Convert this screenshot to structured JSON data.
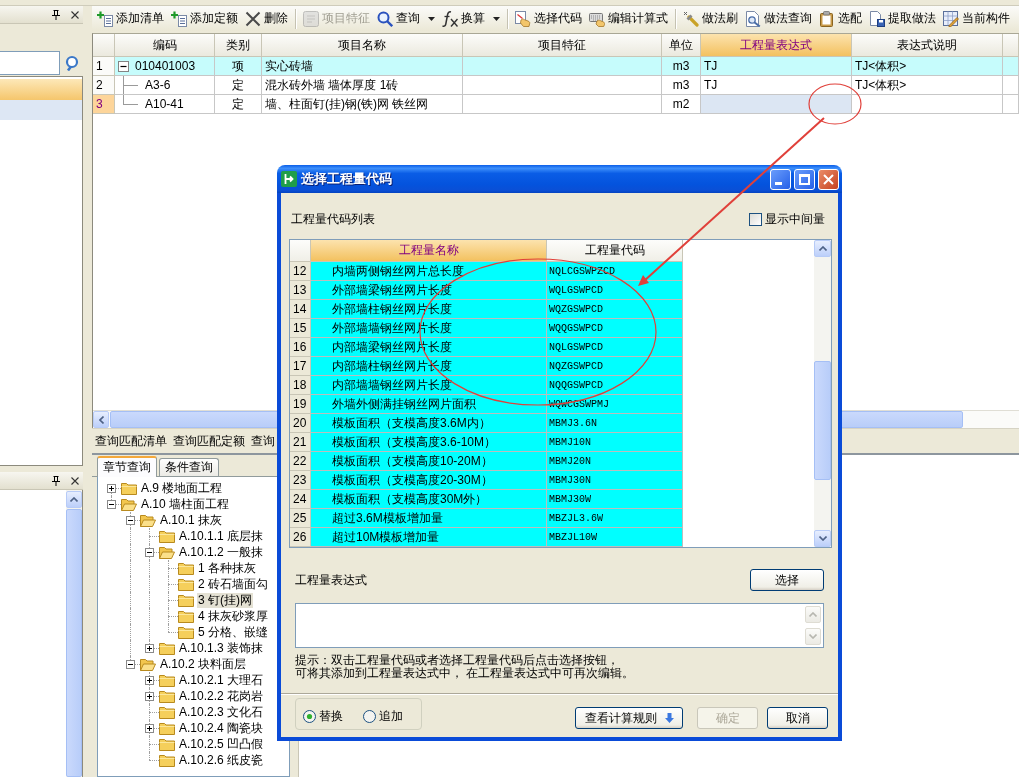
{
  "left_panel": {
    "rows": [
      {
        "selected": true
      },
      {
        "selected": false
      }
    ]
  },
  "toolbar": [
    {
      "kind": "button",
      "label": "添加清单",
      "disabled": false
    },
    {
      "kind": "button",
      "label": "添加定额",
      "disabled": false
    },
    {
      "kind": "button",
      "label": "删除",
      "disabled": false
    },
    {
      "kind": "separator"
    },
    {
      "kind": "button",
      "label": "项目特征",
      "disabled": true
    },
    {
      "kind": "dropdown",
      "label": "查询",
      "disabled": false
    },
    {
      "kind": "dropdown",
      "label": "换算",
      "disabled": false
    },
    {
      "kind": "separator"
    },
    {
      "kind": "button",
      "label": "选择代码",
      "disabled": false
    },
    {
      "kind": "button",
      "label": "编辑计算式",
      "disabled": false
    },
    {
      "kind": "separator"
    },
    {
      "kind": "button",
      "label": "做法刷",
      "disabled": false
    },
    {
      "kind": "button",
      "label": "做法查询",
      "disabled": false
    },
    {
      "kind": "button",
      "label": "选配",
      "disabled": false
    },
    {
      "kind": "button",
      "label": "提取做法",
      "disabled": false
    },
    {
      "kind": "button",
      "label": "当前构件",
      "disabled": false
    }
  ],
  "grid": {
    "columns": [
      {
        "label": "编码",
        "selected": false
      },
      {
        "label": "类别",
        "selected": false
      },
      {
        "label": "项目名称",
        "selected": false
      },
      {
        "label": "项目特征",
        "selected": false
      },
      {
        "label": "单位",
        "selected": false
      },
      {
        "label": "工程量表达式",
        "selected": true
      },
      {
        "label": "表达式说明",
        "selected": false
      }
    ],
    "rows": [
      {
        "number": "1",
        "kind": "bill",
        "expanded": true,
        "selected": false,
        "code": "010401003",
        "category": "项",
        "name": "实心砖墙",
        "unit": "m3",
        "expression": "TJ",
        "description": "TJ<体积>"
      },
      {
        "number": "2",
        "kind": "quota",
        "selected": false,
        "code": "A3-6",
        "category": "定",
        "name": "混水砖外墙 墙体厚度 1砖",
        "unit": "m3",
        "expression": "TJ",
        "description": "TJ<体积>"
      },
      {
        "number": "3",
        "kind": "quota",
        "selected": true,
        "code": "A10-41",
        "category": "定",
        "name": "墙、柱面钉(挂)钢(铁)网 铁丝网",
        "unit": "m2"
      }
    ]
  },
  "query_tabs": [
    "查询匹配清单",
    "查询匹配定额",
    "查询"
  ],
  "chapter_tabs": [
    {
      "label": "章节查询",
      "selected": true
    },
    {
      "label": "条件查询",
      "selected": false
    }
  ],
  "tree": [
    {
      "label": "A.9 楼地面工程",
      "expanded": false,
      "selected": false
    },
    {
      "label": "A.10 墙柱面工程",
      "expanded": true,
      "selected": false,
      "children": [
        {
          "label": "A.10.1 抹灰",
          "expanded": true,
          "selected": false,
          "children": [
            {
              "label": "A.10.1.1 底层抹",
              "selected": false
            },
            {
              "label": "A.10.1.2 一般抹",
              "expanded": true,
              "selected": false,
              "children": [
                {
                  "label": "1 各种抹灰",
                  "selected": false
                },
                {
                  "label": "2 砖石墙面勾",
                  "selected": false
                },
                {
                  "label": "3 钉(挂)网",
                  "selected": true
                },
                {
                  "label": "4 抹灰砂浆厚",
                  "selected": false
                },
                {
                  "label": "5 分格、嵌缝",
                  "selected": false
                }
              ]
            },
            {
              "label": "A.10.1.3 装饰抹",
              "expanded": false,
              "selected": false
            }
          ]
        },
        {
          "label": "A.10.2 块料面层",
          "expanded": true,
          "selected": false,
          "children": [
            {
              "label": "A.10.2.1 大理石",
              "expanded": false,
              "selected": false
            },
            {
              "label": "A.10.2.2 花岗岩",
              "expanded": false,
              "selected": false
            },
            {
              "label": "A.10.2.3 文化石",
              "selected": false
            },
            {
              "label": "A.10.2.4 陶瓷块",
              "expanded": false,
              "selected": false
            },
            {
              "label": "A.10.2.5 凹凸假",
              "selected": false
            },
            {
              "label": "A.10.2.6 纸皮瓷",
              "selected": false
            }
          ]
        }
      ]
    }
  ],
  "dialog": {
    "title": "选择工程量代码",
    "list_label": "工程量代码列表",
    "show_intermediate": {
      "label": "显示中间量",
      "checked": false
    },
    "columns": [
      {
        "label": "工程量名称",
        "selected": true
      },
      {
        "label": "工程量代码",
        "selected": false
      }
    ],
    "rows": [
      {
        "number": "12",
        "name": "内墙两侧钢丝网片总长度",
        "code": "NQLCGSWPZCD"
      },
      {
        "number": "13",
        "name": "外部墙梁钢丝网片长度",
        "code": "WQLGSWPCD"
      },
      {
        "number": "14",
        "name": "外部墙柱钢丝网片长度",
        "code": "WQZGSWPCD"
      },
      {
        "number": "15",
        "name": "外部墙墙钢丝网片长度",
        "code": "WQQGSWPCD"
      },
      {
        "number": "16",
        "name": "内部墙梁钢丝网片长度",
        "code": "NQLGSWPCD"
      },
      {
        "number": "17",
        "name": "内部墙柱钢丝网片长度",
        "code": "NQZGSWPCD"
      },
      {
        "number": "18",
        "name": "内部墙墙钢丝网片长度",
        "code": "NQQGSWPCD"
      },
      {
        "number": "19",
        "name": "外墙外侧满挂钢丝网片面积",
        "code": "WQWCGSWPMJ"
      },
      {
        "number": "20",
        "name": "模板面积（支模高度3.6M内）",
        "code": "MBMJ3.6N"
      },
      {
        "number": "21",
        "name": "模板面积（支模高度3.6-10M）",
        "code": "MBMJ10N"
      },
      {
        "number": "22",
        "name": "模板面积（支模高度10-20M）",
        "code": "MBMJ20N"
      },
      {
        "number": "23",
        "name": "模板面积（支模高度20-30M）",
        "code": "MBMJ30N"
      },
      {
        "number": "24",
        "name": "模板面积（支模高度30M外）",
        "code": "MBMJ30W"
      },
      {
        "number": "25",
        "name": "超过3.6M模板增加量",
        "code": "MBZJL3.6W"
      },
      {
        "number": "26",
        "name": "超过10M模板增加量",
        "code": "MBZJL10W"
      }
    ],
    "expression_label": "工程量表达式",
    "select_button": "选择",
    "hint_lines": [
      "提示：双击工程量代码或者选择工程量代码后点击选择按钮，",
      "可将其添加到工程量表达式中， 在工程量表达式中可再次编辑。"
    ],
    "mode_options": [
      {
        "label": "替换",
        "selected": true
      },
      {
        "label": "追加",
        "selected": false
      }
    ],
    "buttons": [
      {
        "label": "查看计算规则",
        "kind": "menu",
        "disabled": false
      },
      {
        "label": "确定",
        "kind": "plain",
        "disabled": true
      },
      {
        "label": "取消",
        "kind": "plain",
        "disabled": false
      }
    ]
  }
}
